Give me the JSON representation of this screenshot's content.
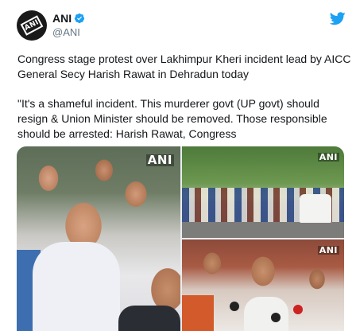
{
  "tweet": {
    "author": {
      "name": "ANI",
      "handle": "@ANI",
      "avatar_text": "ANI",
      "verified": true
    },
    "paragraphs": [
      "Congress stage protest over Lakhimpur Kheri incident lead by AICC General Secy Harish Rawat in Dehradun today",
      "\"It's a shameful incident. This murderer govt (UP govt) should resign & Union Minister should be removed. Those responsible should be arrested: Harish Rawat, Congress"
    ],
    "media": [
      {
        "watermark": "ANI",
        "icon": "photo-protest-crowd"
      },
      {
        "watermark": "ANI",
        "icon": "photo-street-protest"
      },
      {
        "watermark": "ANI",
        "icon": "photo-press-media"
      }
    ]
  },
  "colors": {
    "twitter_blue": "#1da1f2",
    "text_primary": "#14171a",
    "text_secondary": "#657786"
  },
  "icons": {
    "logo": "twitter-bird-icon",
    "verified": "verified-badge-icon"
  }
}
